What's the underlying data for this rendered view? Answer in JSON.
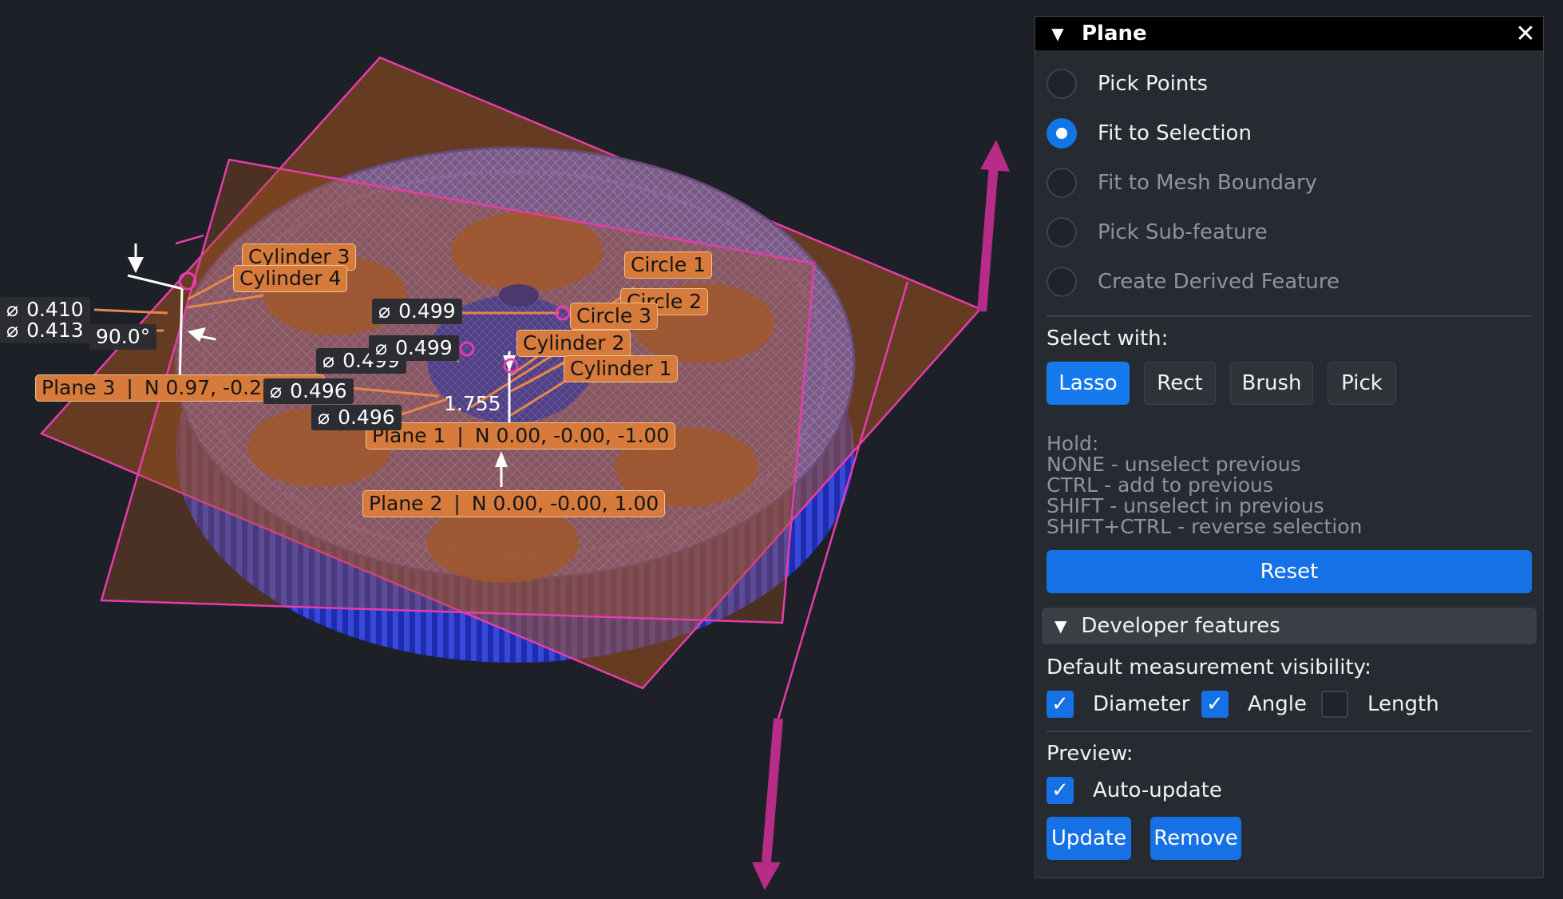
{
  "viewport": {
    "annotations": {
      "cylinder3": "Cylinder 3",
      "cylinder4": "Cylinder 4",
      "circle1": "Circle 1",
      "circle2": "Circle 2",
      "circle3": "Circle 3",
      "cylinder2": "Cylinder 2",
      "cylinder1": "Cylinder 1",
      "plane3_name": "Plane 3",
      "plane3_normal": "N 0.97, -0.22, 0.0",
      "plane1_name": "Plane 1",
      "plane1_normal": "N 0.00, -0.00, -1.00",
      "plane2_name": "Plane 2",
      "plane2_normal": "N 0.00, -0.00, 1.00",
      "diameter_symbol": "⌀",
      "dia_0410": "0.410",
      "dia_0413": "0.413",
      "angle_90": "90.0°",
      "dia_0499a": "0.499",
      "dia_0499b": "0.499",
      "dia_0499c": "0.499",
      "dia_0496a": "0.496",
      "dia_0496b": "0.496",
      "length_1755": "1.755"
    }
  },
  "panel": {
    "title": "Plane",
    "modes": [
      {
        "label": "Pick Points",
        "selected": false,
        "enabled": true
      },
      {
        "label": "Fit to Selection",
        "selected": true,
        "enabled": true
      },
      {
        "label": "Fit to Mesh Boundary",
        "selected": false,
        "enabled": false
      },
      {
        "label": "Pick Sub-feature",
        "selected": false,
        "enabled": false
      },
      {
        "label": "Create Derived Feature",
        "selected": false,
        "enabled": false
      }
    ],
    "select_with_label": "Select with:",
    "select_tools": [
      {
        "label": "Lasso",
        "active": true
      },
      {
        "label": "Rect",
        "active": false
      },
      {
        "label": "Brush",
        "active": false
      },
      {
        "label": "Pick",
        "active": false
      }
    ],
    "hold_lines": [
      "Hold:",
      "NONE - unselect previous",
      "CTRL - add to previous",
      "SHIFT - unselect in previous",
      "SHIFT+CTRL - reverse selection"
    ],
    "reset_label": "Reset",
    "developer_label": "Developer features",
    "default_visibility_label": "Default measurement visibility:",
    "visibility": [
      {
        "label": "Diameter",
        "checked": true
      },
      {
        "label": "Angle",
        "checked": true
      },
      {
        "label": "Length",
        "checked": false
      }
    ],
    "preview_label": "Preview:",
    "auto_update_label": "Auto-update",
    "auto_update_checked": true,
    "update_label": "Update",
    "remove_label": "Remove"
  },
  "colors": {
    "background": "#1d2026",
    "annotation_fill": "#d67b3c",
    "plane_outline": "#e63cad",
    "mesh_blue": "#2a3ccf",
    "axis_arrow": "#b52d86",
    "accent": "#1671e6"
  }
}
